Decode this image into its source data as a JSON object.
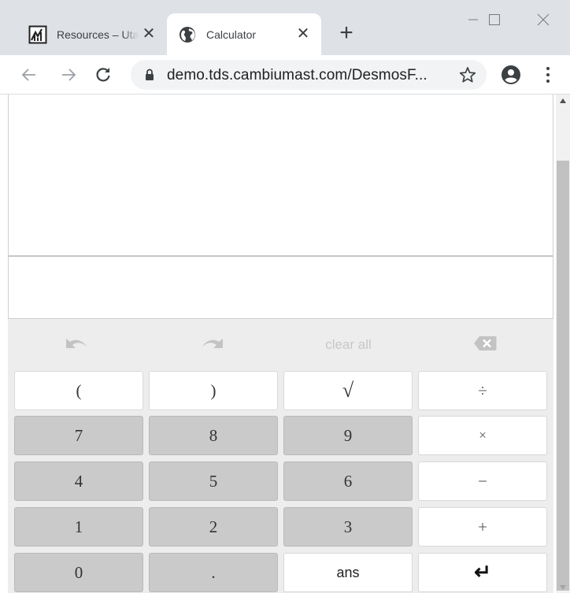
{
  "browser": {
    "tabs": [
      {
        "title": "Resources – Utah",
        "favicon": "chart-logo-icon",
        "close": "✕"
      },
      {
        "title": "Calculator",
        "favicon": "globe-icon",
        "close": "✕"
      }
    ],
    "new_tab": "+",
    "url": "demo.tds.cambiumast.com/DesmosF...",
    "icons": [
      "back-arrow-icon",
      "forward-arrow-icon",
      "reload-icon",
      "lock-icon",
      "star-icon",
      "profile-icon",
      "menu-icon",
      "minimize-icon",
      "maximize-icon",
      "close-window-icon"
    ]
  },
  "calculator": {
    "function_row": {
      "undo": "undo-icon",
      "redo": "redo-icon",
      "clear_all": "clear all",
      "backspace": "backspace-icon"
    },
    "keys": [
      [
        "(",
        ")",
        "√",
        "÷"
      ],
      [
        "7",
        "8",
        "9",
        "×"
      ],
      [
        "4",
        "5",
        "6",
        "−"
      ],
      [
        "1",
        "2",
        "3",
        "+"
      ],
      [
        "0",
        ".",
        "ans",
        "↵"
      ]
    ]
  },
  "colors": {
    "tabstrip": "#dee1e6",
    "keypad_bg": "#ededed",
    "gray_key": "#cacaca",
    "white_key": "#ffffff",
    "scroll_thumb": "#c1c1c1"
  }
}
